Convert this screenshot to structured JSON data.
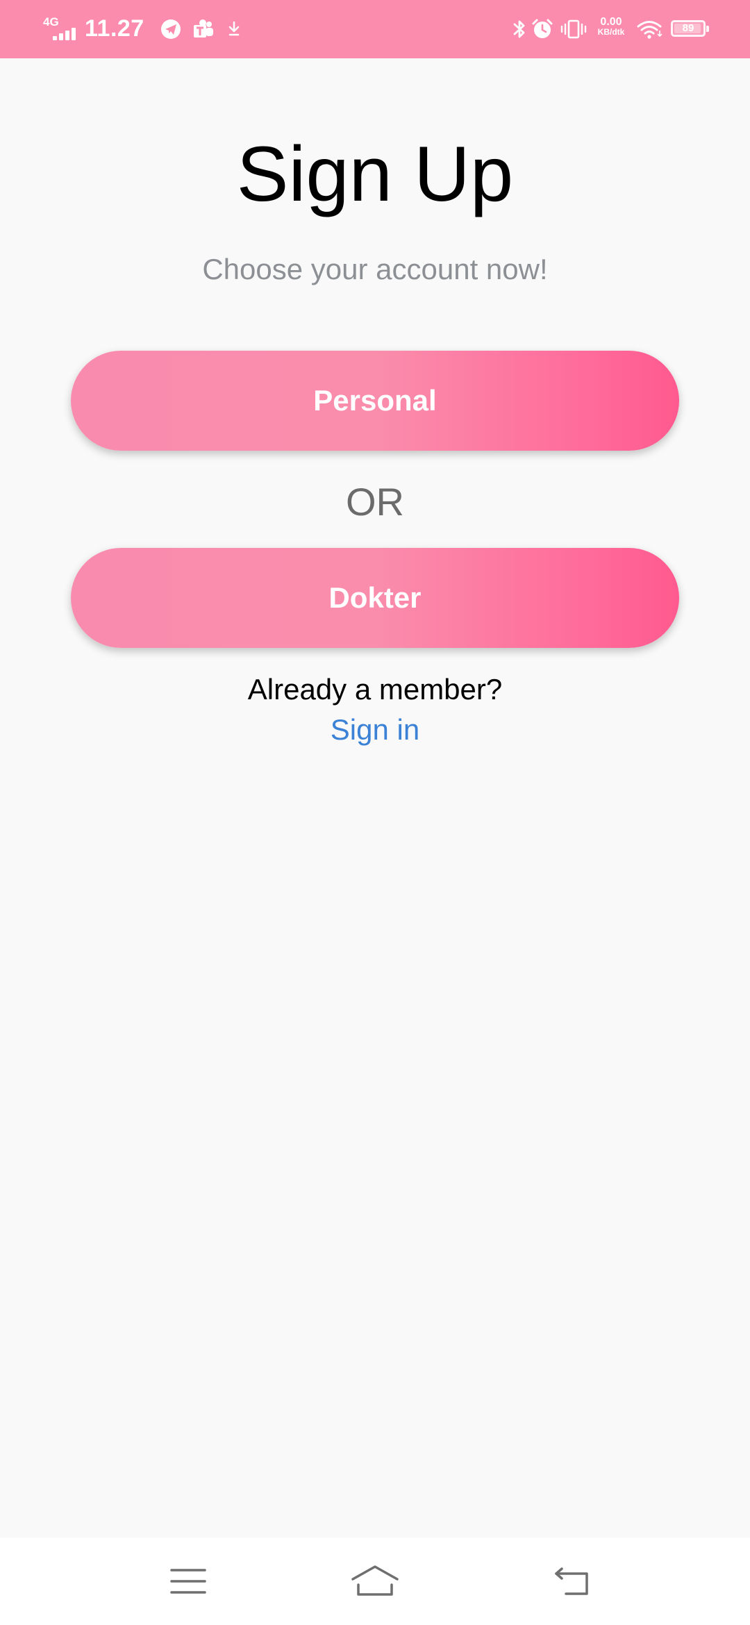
{
  "status_bar": {
    "network": "4G",
    "time": "11.27",
    "speed_value": "0.00",
    "speed_unit": "KB/dtk",
    "battery_percent": 89,
    "battery_label": "89",
    "icons": [
      "telegram-icon",
      "teams-icon",
      "download-icon",
      "bluetooth-icon",
      "alarm-icon",
      "vibrate-icon",
      "wifi-icon",
      "battery-icon"
    ],
    "background_color": "#fb8cae"
  },
  "main": {
    "title": "Sign Up",
    "subtitle": "Choose your account now!",
    "personal_button": "Personal",
    "or_text": "OR",
    "dokter_button": "Dokter",
    "member_prompt": "Already a member?",
    "signin_link": "Sign in"
  },
  "nav_bar": {
    "icons": [
      "menu-icon",
      "home-icon",
      "back-icon"
    ]
  },
  "colors": {
    "accent_start": "#f98cae",
    "accent_end": "#ff5a8f",
    "link": "#3b82d6",
    "background": "#f9f9f9"
  }
}
